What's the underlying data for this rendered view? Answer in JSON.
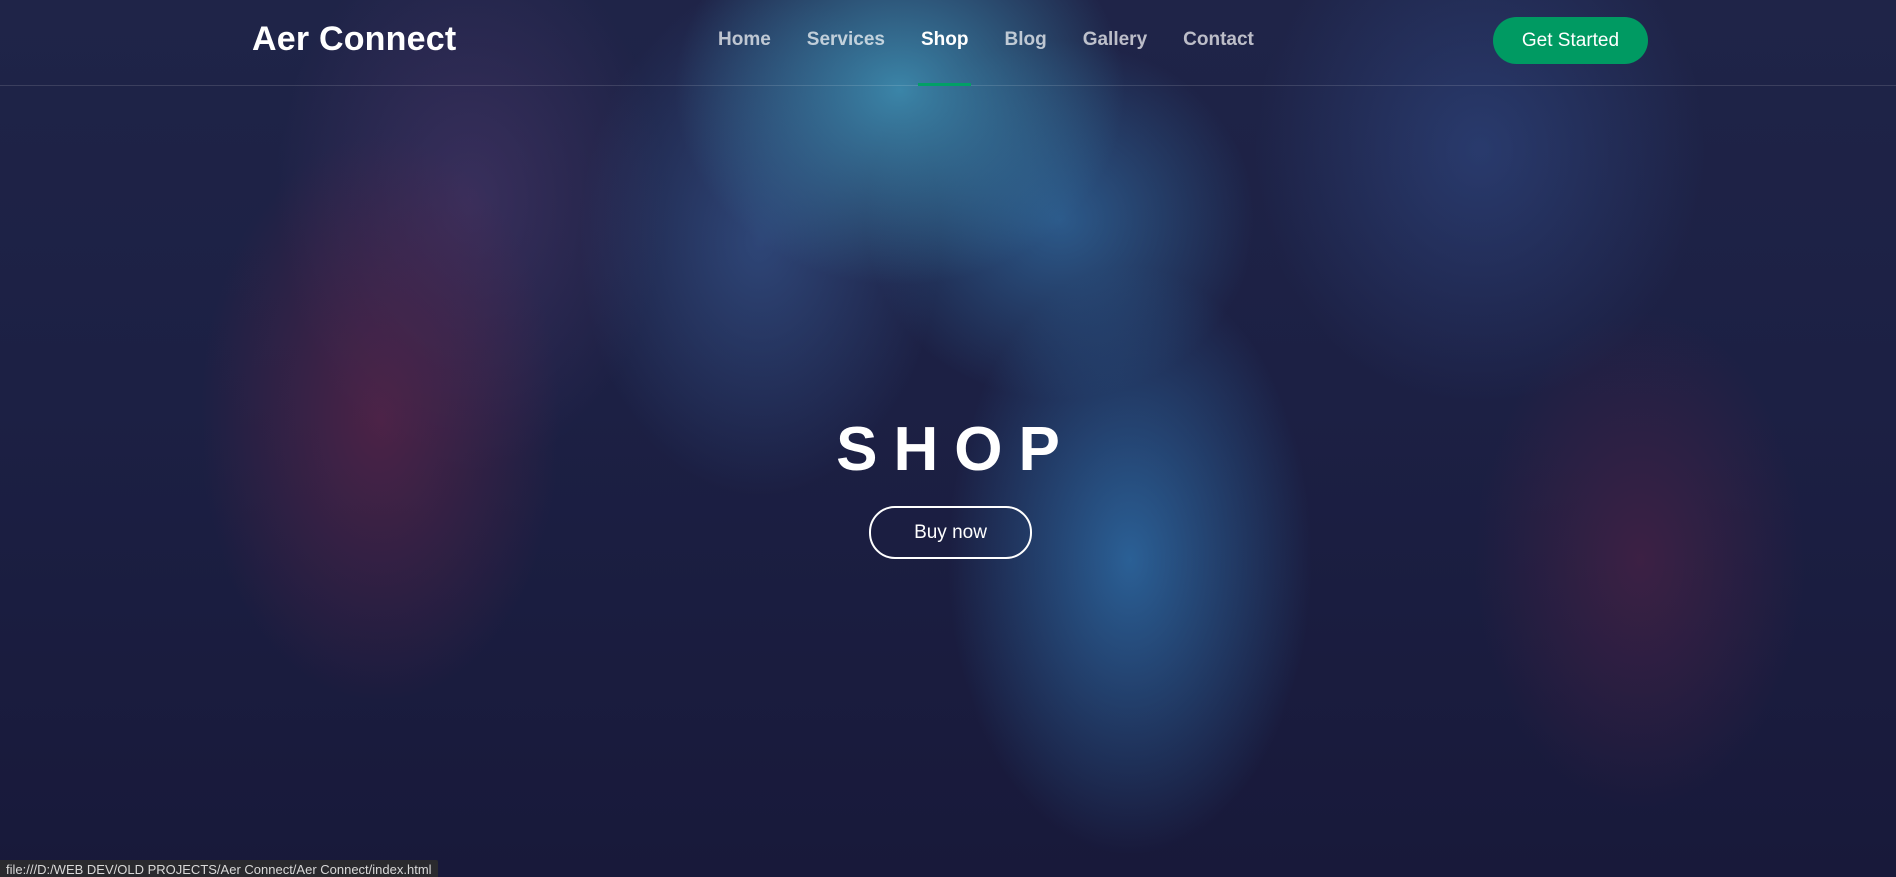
{
  "brand": {
    "name": "Aer Connect"
  },
  "nav": {
    "items": [
      {
        "label": "Home"
      },
      {
        "label": "Services"
      },
      {
        "label": "Shop",
        "active": true
      },
      {
        "label": "Blog"
      },
      {
        "label": "Gallery"
      },
      {
        "label": "Contact"
      }
    ],
    "cta_label": "Get Started"
  },
  "hero": {
    "title": "SHOP",
    "button_label": "Buy now"
  },
  "status_bar": {
    "url": "file:///D:/WEB DEV/OLD PROJECTS/Aer Connect/Aer Connect/index.html"
  },
  "colors": {
    "accent": "#009a62",
    "background": "#1c2044",
    "text": "#ffffff"
  }
}
